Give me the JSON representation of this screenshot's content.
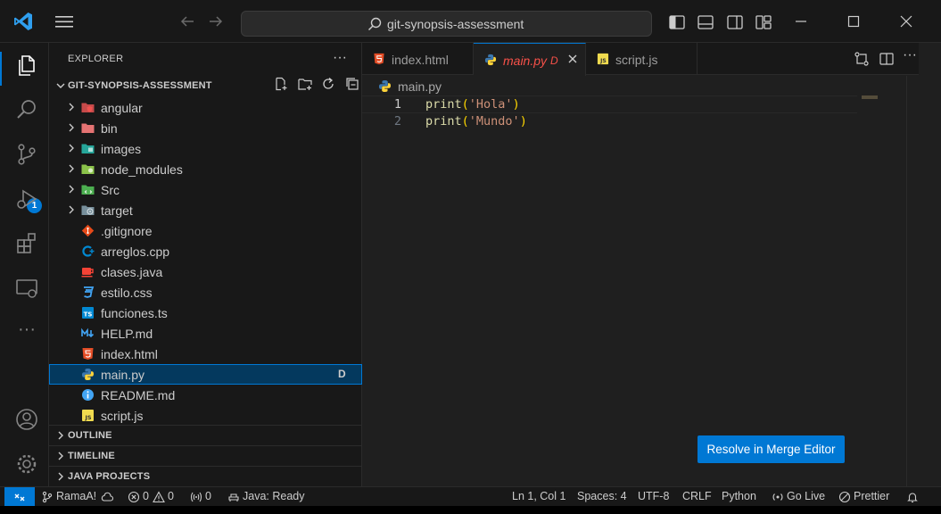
{
  "titlebar": {
    "search_text": "git-synopsis-assessment"
  },
  "activity": {
    "items": [
      "explorer-icon",
      "search-icon",
      "source-control-icon",
      "run-debug-icon",
      "extensions-icon",
      "remote-explorer-icon",
      "more-icon"
    ],
    "scm_badge": "1"
  },
  "sidebar": {
    "title": "EXPLORER",
    "more": "···",
    "root": "GIT-SYNOPSIS-ASSESSMENT",
    "folders": [
      {
        "name": "angular",
        "icon": "angular-folder-icon",
        "color": "#e05050"
      },
      {
        "name": "bin",
        "icon": "bin-folder-icon",
        "color": "#e06060"
      },
      {
        "name": "images",
        "icon": "images-folder-icon",
        "color": "#26a69a"
      },
      {
        "name": "node_modules",
        "icon": "node-modules-folder-icon",
        "color": "#8bc34a"
      },
      {
        "name": "Src",
        "icon": "src-folder-icon",
        "color": "#4caf50"
      },
      {
        "name": "target",
        "icon": "target-folder-icon",
        "color": "#78909c"
      }
    ],
    "files": [
      {
        "name": ".gitignore",
        "icon": "git-icon",
        "color": "#e64a19"
      },
      {
        "name": "arreglos.cpp",
        "icon": "cpp-icon",
        "color": "#0288d1"
      },
      {
        "name": "clases.java",
        "icon": "java-icon",
        "color": "#f44336"
      },
      {
        "name": "estilo.css",
        "icon": "css-icon",
        "color": "#42a5f5"
      },
      {
        "name": "funciones.ts",
        "icon": "typescript-icon",
        "color": "#0288d1"
      },
      {
        "name": "HELP.md",
        "icon": "markdown-icon",
        "color": "#42a5f5"
      },
      {
        "name": "index.html",
        "icon": "html-icon",
        "color": "#e44d26"
      },
      {
        "name": "main.py",
        "icon": "python-icon",
        "color": "#3572a5",
        "selected": true,
        "decoration": "D"
      },
      {
        "name": "README.md",
        "icon": "info-icon",
        "color": "#42a5f5"
      },
      {
        "name": "script.js",
        "icon": "javascript-icon",
        "color": "#f0db4f"
      }
    ],
    "sections": [
      "OUTLINE",
      "TIMELINE",
      "JAVA PROJECTS"
    ]
  },
  "editor": {
    "tabs": [
      {
        "label": "index.html",
        "icon": "html-icon"
      },
      {
        "label": "main.py",
        "icon": "python-icon",
        "active": true,
        "decoration": "D"
      },
      {
        "label": "script.js",
        "icon": "javascript-icon"
      }
    ],
    "breadcrumb": "main.py",
    "lines": [
      {
        "number": "1",
        "fn": "print",
        "open": "(",
        "str": "'Hola'",
        "close": ")"
      },
      {
        "number": "2",
        "fn": "print",
        "open": "(",
        "str": "'Mundo'",
        "close": ")"
      }
    ],
    "merge_button": "Resolve in Merge Editor"
  },
  "status": {
    "branch": "RamaA!",
    "errors": "0",
    "warnings": "0",
    "ports": "0",
    "java": "Java: Ready",
    "position": "Ln 1, Col 1",
    "spaces": "Spaces: 4",
    "encoding": "UTF-8",
    "eol": "CRLF",
    "language": "Python",
    "golive": "Go Live",
    "prettier": "Prettier"
  },
  "colors": {
    "accent": "#0078d4",
    "deleted": "#f85149",
    "selection": "#04395e"
  }
}
